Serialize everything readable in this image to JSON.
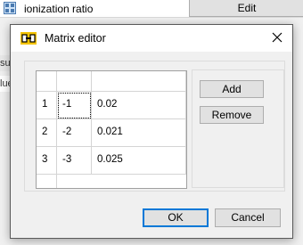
{
  "background": {
    "row_label": "ionization ratio",
    "edit_label": "Edit",
    "fragment_1": "su",
    "fragment_2": "lue"
  },
  "dialog": {
    "title": "Matrix editor",
    "close_label": "✕"
  },
  "table": {
    "rows": [
      {
        "index": "1",
        "a": "-1",
        "b": "0.02"
      },
      {
        "index": "2",
        "a": "-2",
        "b": "0.021"
      },
      {
        "index": "3",
        "a": "-3",
        "b": "0.025"
      }
    ]
  },
  "buttons": {
    "add": "Add",
    "remove": "Remove",
    "ok": "OK",
    "cancel": "Cancel"
  },
  "icons": {
    "row_icon": "grid-icon",
    "title_icon": "matrix-icon",
    "close_icon": "close-icon"
  },
  "colors": {
    "accent": "#0078d7",
    "button_bg": "#e1e1e1",
    "title_icon": "#f5c400"
  }
}
